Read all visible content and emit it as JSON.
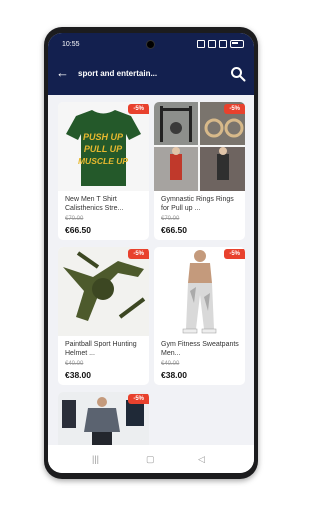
{
  "status_bar": {
    "time": "10:55"
  },
  "header": {
    "title": "sport and entertain..."
  },
  "products": [
    {
      "name": "New Men T Shirt Calisthenics Stre...",
      "old_price": "€70.00",
      "price": "€66.50",
      "discount": "-5%",
      "image_text": [
        "PUSH UP",
        "PULL UP",
        "MUSCLE UP"
      ]
    },
    {
      "name": "Gymnastic Rings Rings for Pull up ...",
      "old_price": "€70.00",
      "price": "€66.50",
      "discount": "-5%"
    },
    {
      "name": "Paintball Sport Hunting Helmet ...",
      "old_price": "€40.00",
      "price": "€38.00",
      "discount": "-5%"
    },
    {
      "name": "Gym Fitness Sweatpants Men...",
      "old_price": "€40.00",
      "price": "€38.00",
      "discount": "-5%"
    },
    {
      "discount": "-5%"
    }
  ],
  "colors": {
    "header_bg": "#13204f",
    "badge_bg": "#e8412d",
    "tshirt": "#24592a",
    "tshirt_text": "#e8b92f"
  },
  "icons": {
    "back": "arrow-left-icon",
    "search": "search-icon"
  }
}
